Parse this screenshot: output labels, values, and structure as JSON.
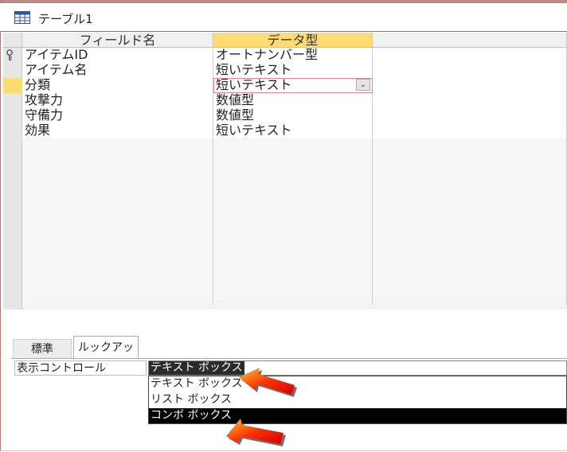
{
  "window": {
    "title": "テーブル1",
    "icon": "table-icon"
  },
  "grid": {
    "headers": {
      "field_name": "フィールド名",
      "data_type": "データ型",
      "description": ""
    },
    "rows": [
      {
        "name": "アイテムID",
        "type": "オートナンバー型",
        "primary_key": true
      },
      {
        "name": "アイテム名",
        "type": "短いテキスト"
      },
      {
        "name": "分類",
        "type": "短いテキスト",
        "current": true
      },
      {
        "name": "攻撃力",
        "type": "数値型"
      },
      {
        "name": "守備力",
        "type": "数値型"
      },
      {
        "name": "効果",
        "type": "短いテキスト"
      }
    ]
  },
  "properties": {
    "tabs": [
      {
        "label": "標準"
      },
      {
        "label": "ルックアップ"
      }
    ],
    "active_tab": "ルックアップ",
    "display_control": {
      "label": "表示コントロール",
      "value": "テキスト ボックス",
      "options": [
        "テキスト ボックス",
        "リスト ボックス",
        "コンボ ボックス"
      ],
      "highlighted": "コンボ ボックス"
    }
  },
  "colors": {
    "accent": "#ffdc73",
    "highlight": "#000000",
    "arrow": "#e60000"
  }
}
